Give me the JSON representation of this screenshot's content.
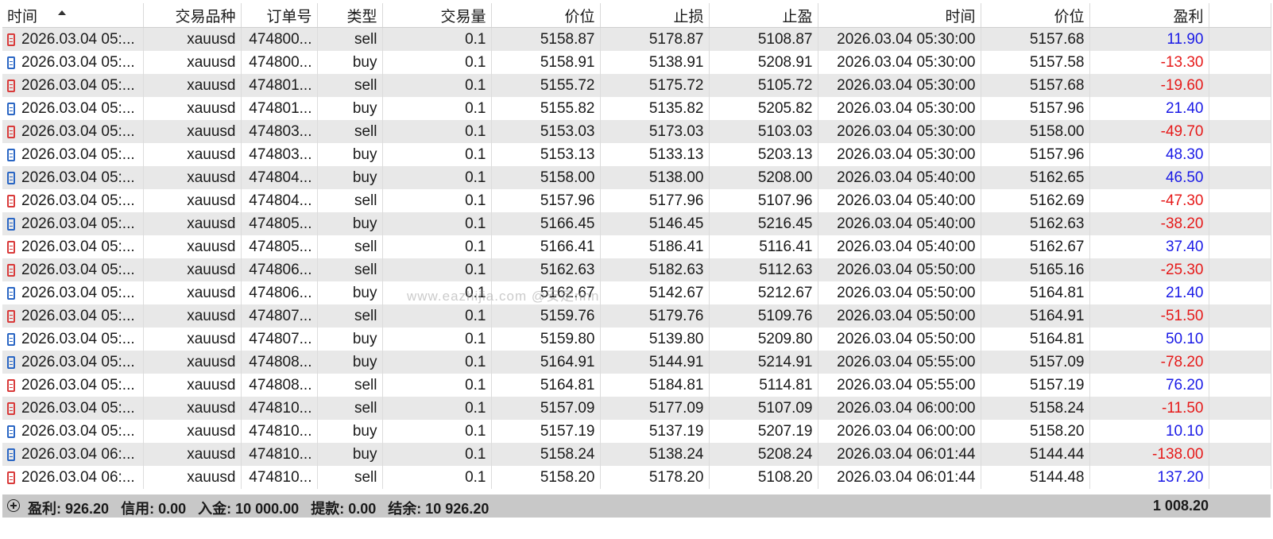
{
  "columns": [
    {
      "key": "open_time",
      "label": "时间"
    },
    {
      "key": "symbol",
      "label": "交易品种"
    },
    {
      "key": "order",
      "label": "订单号"
    },
    {
      "key": "type",
      "label": "类型"
    },
    {
      "key": "volume",
      "label": "交易量"
    },
    {
      "key": "open_price",
      "label": "价位"
    },
    {
      "key": "sl",
      "label": "止损"
    },
    {
      "key": "tp",
      "label": "止盈"
    },
    {
      "key": "close_time",
      "label": "时间"
    },
    {
      "key": "close_price",
      "label": "价位"
    },
    {
      "key": "profit",
      "label": "盈利"
    }
  ],
  "sort": {
    "column": "open_time",
    "direction": "asc",
    "icon": "sort-ascending-icon"
  },
  "icons": {
    "sell": "sell-order-doc-icon",
    "buy": "buy-order-doc-icon",
    "summary_toggle": "expand-plus-icon"
  },
  "colors": {
    "positive_profit": "#1a1ae6",
    "negative_profit": "#e61a1a",
    "sell_icon": "#d93a3a",
    "buy_icon": "#2a66c4",
    "footer_bg": "#c8c8c8",
    "row_alt_bg": "#e8e8e8"
  },
  "rows": [
    {
      "open_time": "2026.03.04 05:...",
      "symbol": "xauusd",
      "order": "474800...",
      "type": "sell",
      "volume": "0.1",
      "open_price": "5158.87",
      "sl": "5178.87",
      "tp": "5108.87",
      "close_time": "2026.03.04 05:30:00",
      "close_price": "5157.68",
      "profit": "11.90"
    },
    {
      "open_time": "2026.03.04 05:...",
      "symbol": "xauusd",
      "order": "474800...",
      "type": "buy",
      "volume": "0.1",
      "open_price": "5158.91",
      "sl": "5138.91",
      "tp": "5208.91",
      "close_time": "2026.03.04 05:30:00",
      "close_price": "5157.58",
      "profit": "-13.30"
    },
    {
      "open_time": "2026.03.04 05:...",
      "symbol": "xauusd",
      "order": "474801...",
      "type": "sell",
      "volume": "0.1",
      "open_price": "5155.72",
      "sl": "5175.72",
      "tp": "5105.72",
      "close_time": "2026.03.04 05:30:00",
      "close_price": "5157.68",
      "profit": "-19.60"
    },
    {
      "open_time": "2026.03.04 05:...",
      "symbol": "xauusd",
      "order": "474801...",
      "type": "buy",
      "volume": "0.1",
      "open_price": "5155.82",
      "sl": "5135.82",
      "tp": "5205.82",
      "close_time": "2026.03.04 05:30:00",
      "close_price": "5157.96",
      "profit": "21.40"
    },
    {
      "open_time": "2026.03.04 05:...",
      "symbol": "xauusd",
      "order": "474803...",
      "type": "sell",
      "volume": "0.1",
      "open_price": "5153.03",
      "sl": "5173.03",
      "tp": "5103.03",
      "close_time": "2026.03.04 05:30:00",
      "close_price": "5158.00",
      "profit": "-49.70"
    },
    {
      "open_time": "2026.03.04 05:...",
      "symbol": "xauusd",
      "order": "474803...",
      "type": "buy",
      "volume": "0.1",
      "open_price": "5153.13",
      "sl": "5133.13",
      "tp": "5203.13",
      "close_time": "2026.03.04 05:30:00",
      "close_price": "5157.96",
      "profit": "48.30"
    },
    {
      "open_time": "2026.03.04 05:...",
      "symbol": "xauusd",
      "order": "474804...",
      "type": "buy",
      "volume": "0.1",
      "open_price": "5158.00",
      "sl": "5138.00",
      "tp": "5208.00",
      "close_time": "2026.03.04 05:40:00",
      "close_price": "5162.65",
      "profit": "46.50"
    },
    {
      "open_time": "2026.03.04 05:...",
      "symbol": "xauusd",
      "order": "474804...",
      "type": "sell",
      "volume": "0.1",
      "open_price": "5157.96",
      "sl": "5177.96",
      "tp": "5107.96",
      "close_time": "2026.03.04 05:40:00",
      "close_price": "5162.69",
      "profit": "-47.30"
    },
    {
      "open_time": "2026.03.04 05:...",
      "symbol": "xauusd",
      "order": "474805...",
      "type": "buy",
      "volume": "0.1",
      "open_price": "5166.45",
      "sl": "5146.45",
      "tp": "5216.45",
      "close_time": "2026.03.04 05:40:00",
      "close_price": "5162.63",
      "profit": "-38.20"
    },
    {
      "open_time": "2026.03.04 05:...",
      "symbol": "xauusd",
      "order": "474805...",
      "type": "sell",
      "volume": "0.1",
      "open_price": "5166.41",
      "sl": "5186.41",
      "tp": "5116.41",
      "close_time": "2026.03.04 05:40:00",
      "close_price": "5162.67",
      "profit": "37.40"
    },
    {
      "open_time": "2026.03.04 05:...",
      "symbol": "xauusd",
      "order": "474806...",
      "type": "sell",
      "volume": "0.1",
      "open_price": "5162.63",
      "sl": "5182.63",
      "tp": "5112.63",
      "close_time": "2026.03.04 05:50:00",
      "close_price": "5165.16",
      "profit": "-25.30"
    },
    {
      "open_time": "2026.03.04 05:...",
      "symbol": "xauusd",
      "order": "474806...",
      "type": "buy",
      "volume": "0.1",
      "open_price": "5162.67",
      "sl": "5142.67",
      "tp": "5212.67",
      "close_time": "2026.03.04 05:50:00",
      "close_price": "5164.81",
      "profit": "21.40"
    },
    {
      "open_time": "2026.03.04 05:...",
      "symbol": "xauusd",
      "order": "474807...",
      "type": "sell",
      "volume": "0.1",
      "open_price": "5159.76",
      "sl": "5179.76",
      "tp": "5109.76",
      "close_time": "2026.03.04 05:50:00",
      "close_price": "5164.91",
      "profit": "-51.50"
    },
    {
      "open_time": "2026.03.04 05:...",
      "symbol": "xauusd",
      "order": "474807...",
      "type": "buy",
      "volume": "0.1",
      "open_price": "5159.80",
      "sl": "5139.80",
      "tp": "5209.80",
      "close_time": "2026.03.04 05:50:00",
      "close_price": "5164.81",
      "profit": "50.10"
    },
    {
      "open_time": "2026.03.04 05:...",
      "symbol": "xauusd",
      "order": "474808...",
      "type": "buy",
      "volume": "0.1",
      "open_price": "5164.91",
      "sl": "5144.91",
      "tp": "5214.91",
      "close_time": "2026.03.04 05:55:00",
      "close_price": "5157.09",
      "profit": "-78.20"
    },
    {
      "open_time": "2026.03.04 05:...",
      "symbol": "xauusd",
      "order": "474808...",
      "type": "sell",
      "volume": "0.1",
      "open_price": "5164.81",
      "sl": "5184.81",
      "tp": "5114.81",
      "close_time": "2026.03.04 05:55:00",
      "close_price": "5157.19",
      "profit": "76.20"
    },
    {
      "open_time": "2026.03.04 05:...",
      "symbol": "xauusd",
      "order": "474810...",
      "type": "sell",
      "volume": "0.1",
      "open_price": "5157.09",
      "sl": "5177.09",
      "tp": "5107.09",
      "close_time": "2026.03.04 06:00:00",
      "close_price": "5158.24",
      "profit": "-11.50"
    },
    {
      "open_time": "2026.03.04 05:...",
      "symbol": "xauusd",
      "order": "474810...",
      "type": "buy",
      "volume": "0.1",
      "open_price": "5157.19",
      "sl": "5137.19",
      "tp": "5207.19",
      "close_time": "2026.03.04 06:00:00",
      "close_price": "5158.20",
      "profit": "10.10"
    },
    {
      "open_time": "2026.03.04 06:...",
      "symbol": "xauusd",
      "order": "474810...",
      "type": "buy",
      "volume": "0.1",
      "open_price": "5158.24",
      "sl": "5138.24",
      "tp": "5208.24",
      "close_time": "2026.03.04 06:01:44",
      "close_price": "5144.44",
      "profit": "-138.00"
    },
    {
      "open_time": "2026.03.04 06:...",
      "symbol": "xauusd",
      "order": "474810...",
      "type": "sell",
      "volume": "0.1",
      "open_price": "5158.20",
      "sl": "5178.20",
      "tp": "5108.20",
      "close_time": "2026.03.04 06:01:44",
      "close_price": "5144.48",
      "profit": "137.20"
    }
  ],
  "footer": {
    "profit": "盈利: 926.20",
    "credit": "信用: 0.00",
    "deposit": "入金: 10 000.00",
    "withdrawal": "提款: 0.00",
    "balance": "结余: 10 926.20",
    "total_profit": "1 008.20"
  },
  "watermark": "www.eazhijia.com @安定nnn"
}
